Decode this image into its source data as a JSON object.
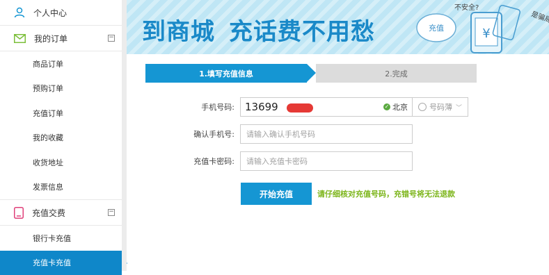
{
  "sidebar": {
    "user_center": "个人中心",
    "orders": {
      "title": "我的订单",
      "expand": "⊟",
      "items": [
        "商品订单",
        "预购订单",
        "充值订单",
        "我的收藏",
        "收货地址",
        "发票信息"
      ]
    },
    "recharge": {
      "title": "充值交费",
      "expand": "⊟",
      "items": [
        "银行卡充值",
        "充值卡充值"
      ],
      "active": "充值卡充值"
    }
  },
  "banner": {
    "title_left": "到商城",
    "title_right": "充话费不用愁",
    "badge": "充值",
    "note1": "不安全?",
    "note2": "是骗局?",
    "currency": "¥"
  },
  "steps": {
    "step1": "1.填写充值信息",
    "step2": "2.完成"
  },
  "form": {
    "phone_label": "手机号码:",
    "phone_value": "13699",
    "phone_city": "北京",
    "phonebook": "号码薄",
    "confirm_label": "确认手机号:",
    "confirm_placeholder": "请输入确认手机号码",
    "pwd_label": "充值卡密码:",
    "pwd_placeholder": "请输入充值卡密码",
    "submit": "开始充值",
    "hint": "请仔细核对充值号码，充错号将无法退款"
  },
  "colors": {
    "accent": "#1596d3",
    "hint": "#7cb51a",
    "banner_bg": "#bfe6f5"
  }
}
